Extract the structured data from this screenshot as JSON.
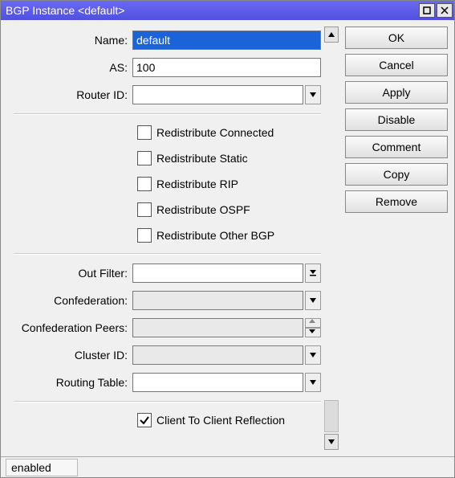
{
  "window": {
    "title": "BGP Instance <default>"
  },
  "buttons": {
    "ok": "OK",
    "cancel": "Cancel",
    "apply": "Apply",
    "disable": "Disable",
    "comment": "Comment",
    "copy": "Copy",
    "remove": "Remove"
  },
  "fields": {
    "name_label": "Name:",
    "name_value": "default",
    "as_label": "AS:",
    "as_value": "100",
    "router_id_label": "Router ID:",
    "router_id_value": "",
    "out_filter_label": "Out Filter:",
    "out_filter_value": "",
    "confederation_label": "Confederation:",
    "confederation_value": "",
    "confed_peers_label": "Confederation Peers:",
    "confed_peers_value": "",
    "cluster_id_label": "Cluster ID:",
    "cluster_id_value": "",
    "routing_table_label": "Routing Table:",
    "routing_table_value": ""
  },
  "checks": {
    "redist_connected": "Redistribute Connected",
    "redist_static": "Redistribute Static",
    "redist_rip": "Redistribute RIP",
    "redist_ospf": "Redistribute OSPF",
    "redist_other_bgp": "Redistribute Other BGP",
    "client_reflection": "Client To Client Reflection"
  },
  "status": {
    "text": "enabled"
  }
}
